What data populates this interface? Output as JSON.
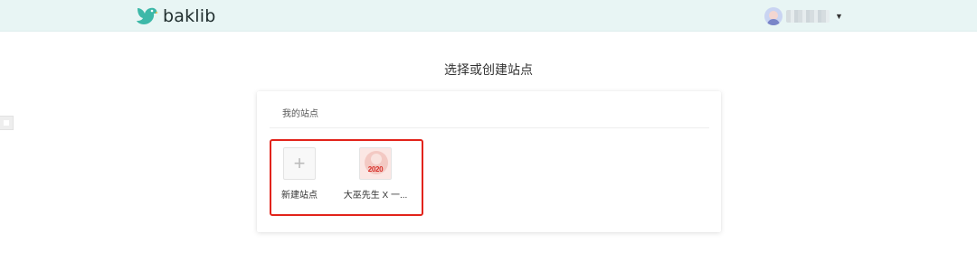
{
  "header": {
    "brand": "baklib",
    "brand_color": "#3db8a8",
    "user_menu_icon": "caret-down-icon"
  },
  "page": {
    "title": "选择或创建站点"
  },
  "sites_card": {
    "section_label": "我的站点",
    "items": [
      {
        "label": "新建站点",
        "icon": "plus-icon"
      },
      {
        "label": "大巫先生 X 一...",
        "thumbnail_text": "2020"
      }
    ],
    "highlight_color": "#e2231a"
  }
}
